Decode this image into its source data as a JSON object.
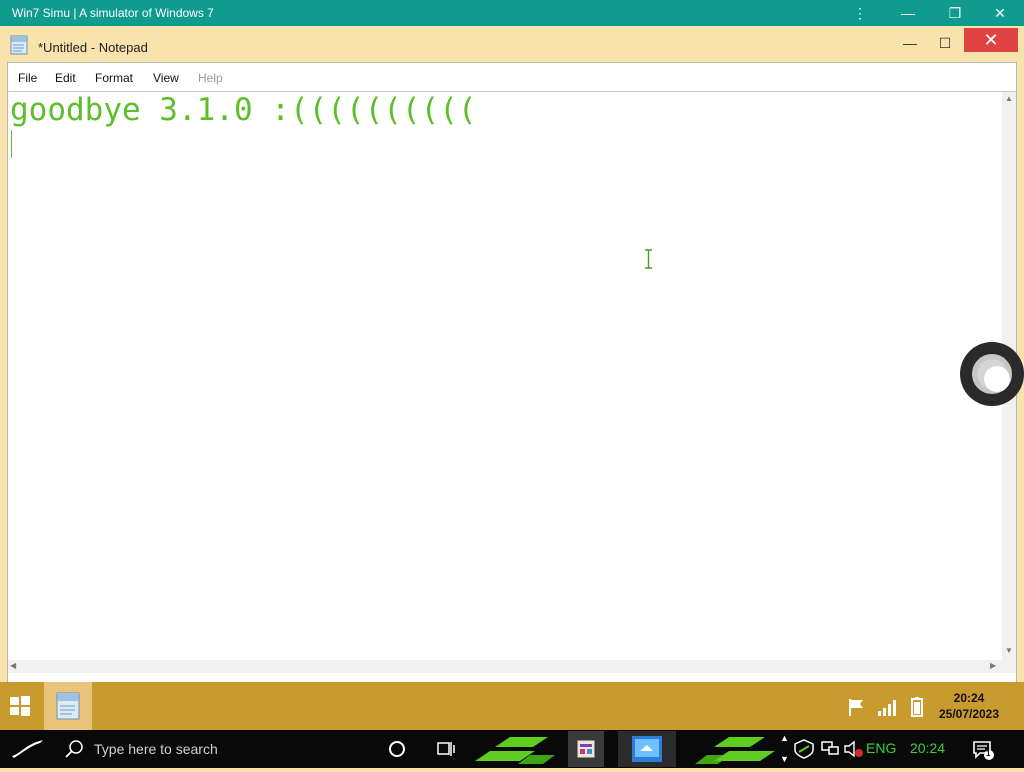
{
  "host": {
    "title": "Win7 Simu | A simulator of Windows 7",
    "menu_icon": "kebab-menu-icon",
    "min_icon": "minimize-icon",
    "restore_icon": "restore-icon",
    "close_icon": "close-icon"
  },
  "notepad": {
    "title": "*Untitled - Notepad",
    "menu": [
      "File",
      "Edit",
      "Format",
      "View",
      "Help"
    ],
    "content": "goodbye 3.1.0 :(((((((((("
  },
  "taskbar1": {
    "time": "20:24",
    "date": "25/07/2023"
  },
  "taskbar2": {
    "search_placeholder": "Type here to search",
    "language": "ENG",
    "time": "20:24",
    "notification_count": "1"
  },
  "colors": {
    "accent": "#0f9b8e",
    "notepad_text": "#5ebe2a",
    "taskbar": "#c99a2d",
    "close": "#e04343"
  }
}
